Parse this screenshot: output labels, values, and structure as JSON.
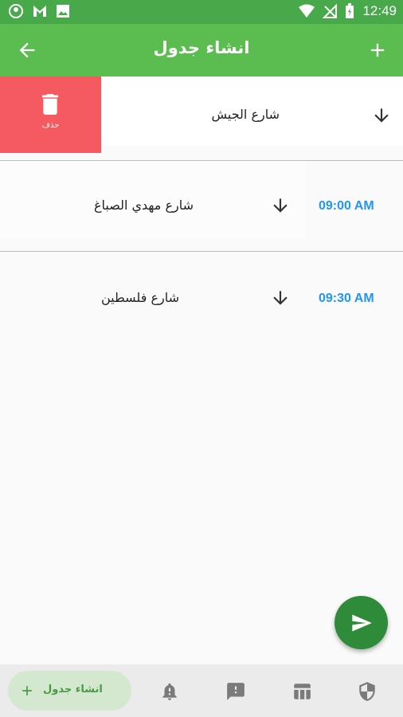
{
  "status_bar": {
    "time": "12:49"
  },
  "app_bar": {
    "title": "انشاء جدول"
  },
  "rows": [
    {
      "street": "شارع الجيش",
      "time": "",
      "delete_label": "حذف"
    },
    {
      "street": "شارع مهدي الصباغ",
      "time": "09:00  AM"
    },
    {
      "street": "شارع فلسطين",
      "time": "09:30  AM"
    }
  ],
  "bottom_nav": {
    "active_label": "انشاء جدول"
  },
  "colors": {
    "primary": "#5bbd4f",
    "status_bar": "#47a94a",
    "delete": "#f45a5f",
    "time": "#2196f3",
    "fab": "#2e8b3a"
  }
}
